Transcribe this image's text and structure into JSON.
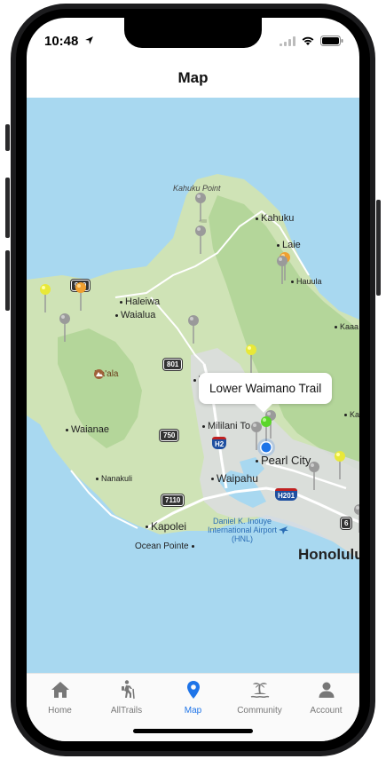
{
  "status": {
    "time": "10:48"
  },
  "header": {
    "title": "Map"
  },
  "map": {
    "callout": "Lower Waimano Trail",
    "places": {
      "kahuku_point": "Kahuku Point",
      "kahuku": "Kahuku",
      "laie": "Laie",
      "hauula": "Hauula",
      "haleiwa": "Haleiwa",
      "waialua": "Waialua",
      "kaaawa": "Kaaa",
      "kaala": "Ka'ala",
      "waianae": "Waianae",
      "nanakuli": "Nanakuli",
      "mililani": "Mililani To",
      "pearl_city": "Pearl City",
      "waipahu": "Waipahu",
      "kapolei": "Kapolei",
      "ocean_pointe": "Ocean Pointe",
      "airport": "Daniel K. Inouye International Airport (HNL)",
      "honolulu": "Honolulu",
      "wahiawa": "W",
      "ka": "Ka"
    },
    "shields": {
      "r930": "930",
      "r801": "801",
      "r750": "750",
      "r7110": "7110",
      "h2": "H2",
      "h201": "H201",
      "r6": "6"
    },
    "colors": {
      "water": "#a8d8f0",
      "land": "#cfe3b6",
      "forest": "#a9cf8f",
      "urban": "#dcdde0",
      "road": "#ffffff"
    }
  },
  "tabs": [
    {
      "label": "Home",
      "icon": "home-icon"
    },
    {
      "label": "AllTrails",
      "icon": "hiker-icon"
    },
    {
      "label": "Map",
      "icon": "map-pin-icon",
      "active": true
    },
    {
      "label": "Community",
      "icon": "island-icon"
    },
    {
      "label": "Account",
      "icon": "person-icon"
    }
  ],
  "accent": "#1e74e8"
}
